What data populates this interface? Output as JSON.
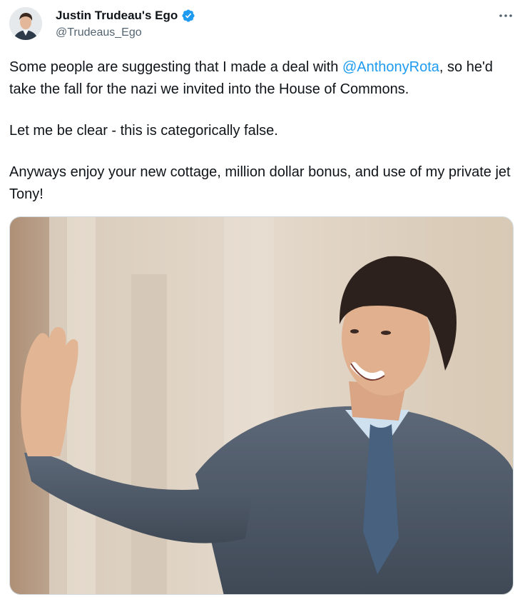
{
  "author": {
    "display_name": "Justin Trudeau's Ego",
    "handle": "@Trudeaus_Ego",
    "verified": true,
    "avatar_icon": "profile-photo"
  },
  "tweet": {
    "para1_before": "Some people are suggesting that I made a deal with ",
    "para1_mention": "@AnthonyRota",
    "para1_after": ", so he'd take the fall for the nazi we invited into the House of Commons.",
    "para2": "Let me be clear - this is categorically false.",
    "para3": "Anyways enjoy your new cottage, million dollar bonus, and use of my private jet Tony!"
  },
  "media": {
    "description_icon": "photo-man-waving"
  },
  "colors": {
    "accent": "#1d9bf0",
    "text": "#0f1419",
    "secondary_text": "#536471",
    "border": "#cfd9de"
  },
  "icons": {
    "more": "more-icon",
    "verified": "verified-badge-icon"
  }
}
